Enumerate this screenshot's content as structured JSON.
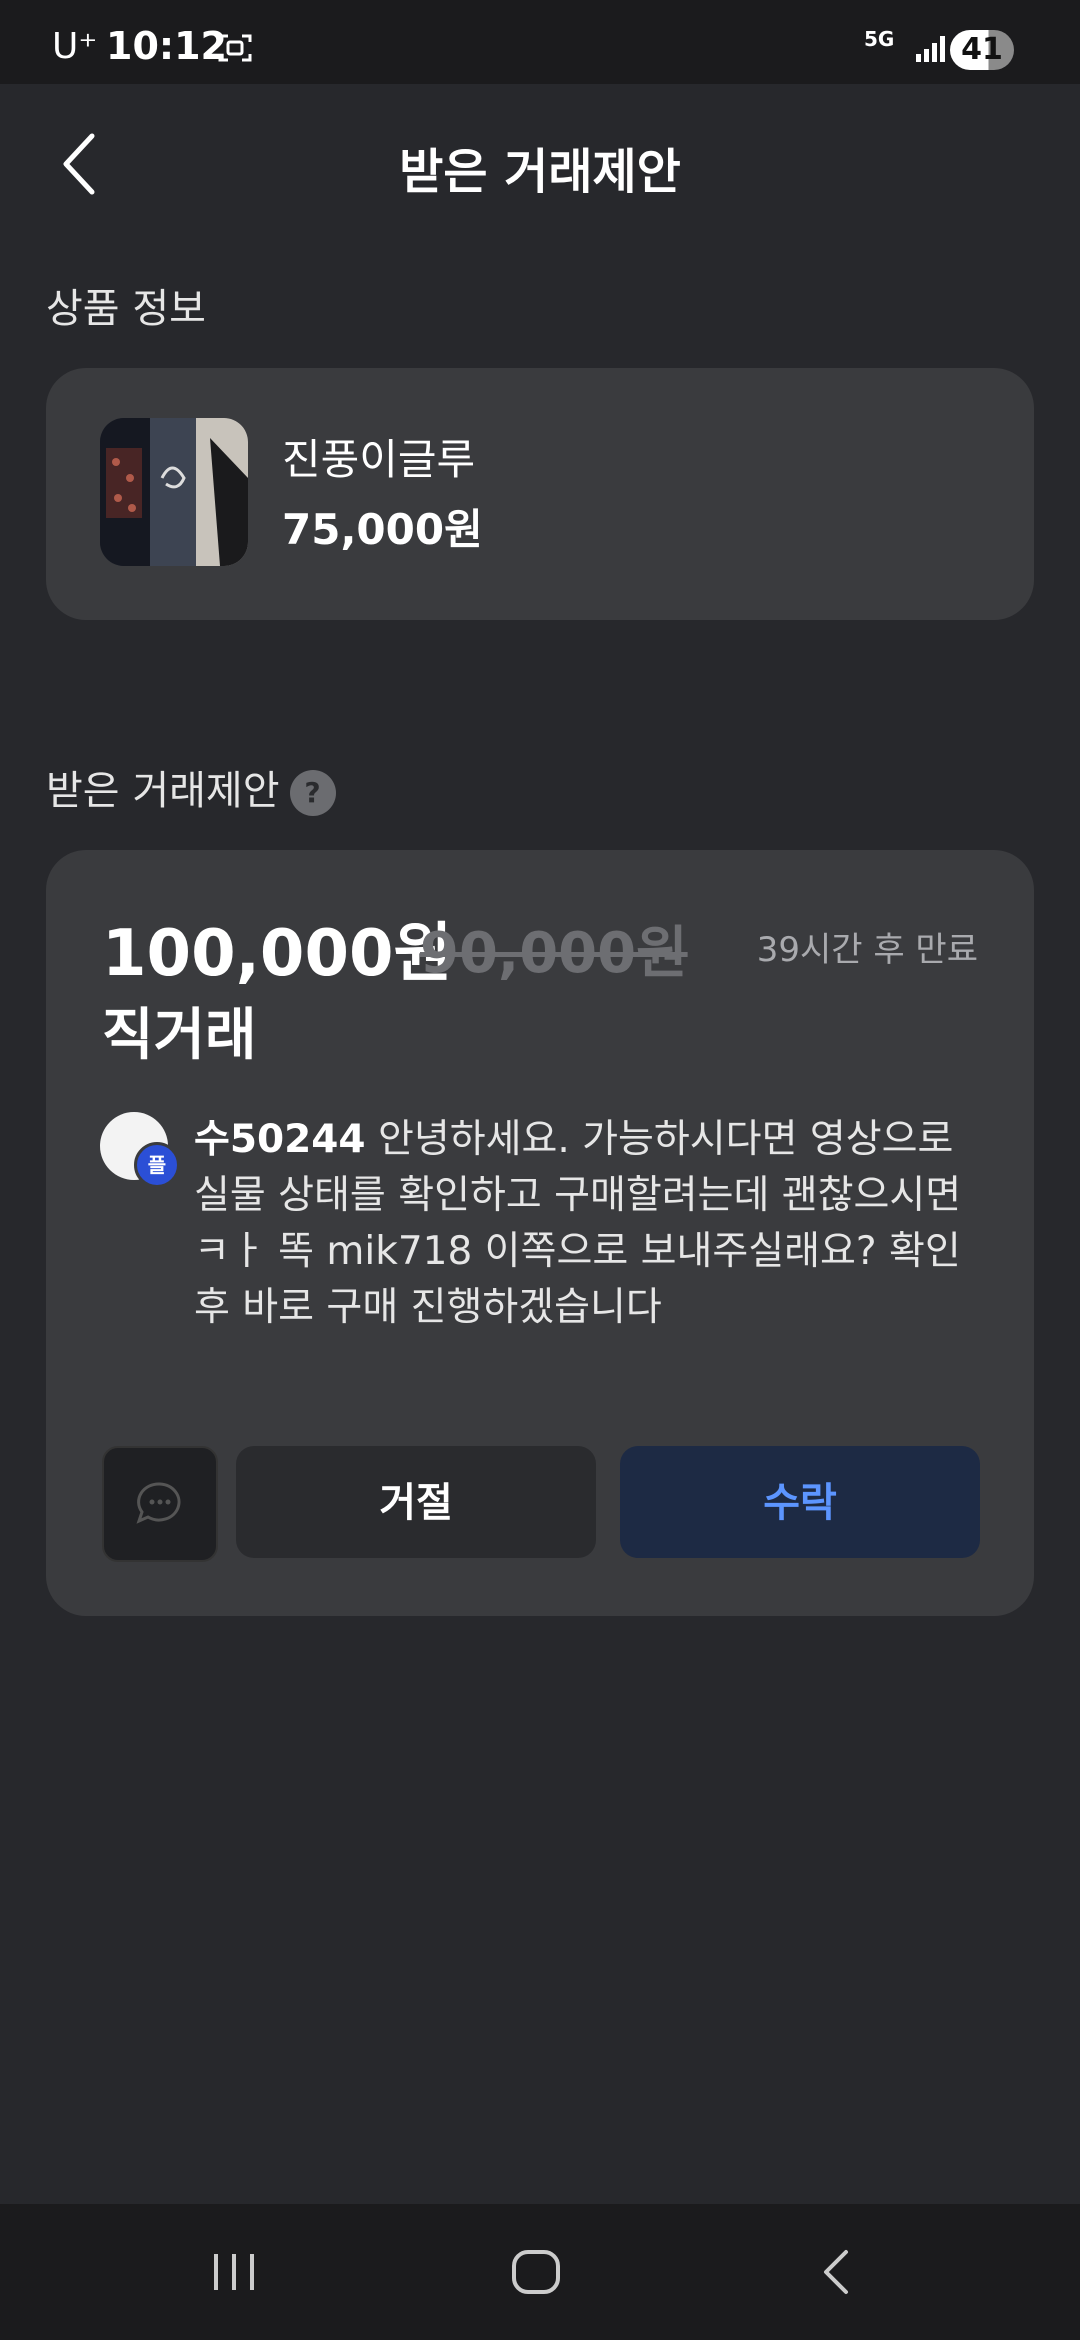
{
  "status_bar": {
    "carrier": "U⁺",
    "time": "10:12",
    "network": "5G",
    "battery": "41"
  },
  "header": {
    "title": "받은 거래제안"
  },
  "product_section": {
    "title": "상품 정보",
    "product": {
      "name": "진풍이글루",
      "price": "75,000원"
    }
  },
  "offer_section": {
    "title": "받은 거래제안",
    "help_icon_label": "?",
    "offer": {
      "price": "100,000원",
      "original_price": "90,000원",
      "expiry": "39시간 후 만료",
      "deal_type": "직거래",
      "username": "수50244",
      "avatar_badge": "플",
      "message": "안녕하세요. 가능하시다면 영상으로 실물 상태를 확인하고 구매할려는데 괜찮으시면 ㅋㅏ 똑 mik718 이쪽으로 보내주실래요? 확인 후 바로 구매 진행하겠습니다",
      "reject_label": "거절",
      "accept_label": "수락"
    }
  },
  "colors": {
    "background": "#27282c",
    "card": "#3a3b3e",
    "accent": "#5c95ff",
    "accept_bg": "#1d2a44"
  }
}
